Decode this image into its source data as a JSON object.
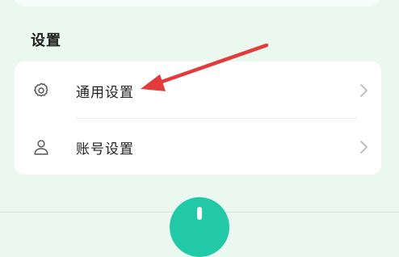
{
  "section": {
    "title": "设置"
  },
  "settings_items": [
    {
      "label": "通用设置",
      "icon": "gear-icon"
    },
    {
      "label": "账号设置",
      "icon": "user-icon"
    }
  ],
  "colors": {
    "background": "#eaf8f0",
    "card": "#ffffff",
    "accent": "#22c9a6",
    "annotation_arrow": "#e23b3b"
  }
}
